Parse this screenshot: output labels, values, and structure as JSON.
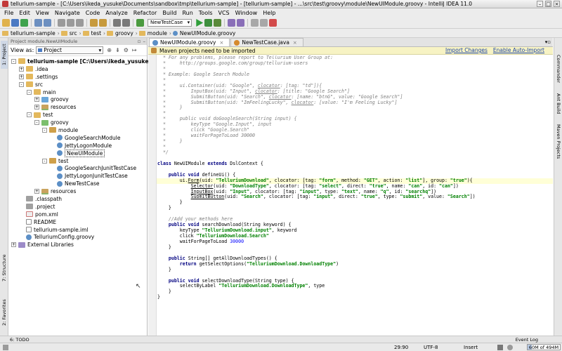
{
  "window": {
    "title": "tellurium-sample - [C:\\Users\\ikeda_yusuke\\Documents\\sandbox\\tmp\\tellurium-sample] - [tellurium-sample] - ...\\src\\test\\groovy\\module\\NewUIModule.groovy - IntelliJ IDEA 11.0"
  },
  "menu": [
    "File",
    "Edit",
    "View",
    "Navigate",
    "Code",
    "Analyze",
    "Refactor",
    "Build",
    "Run",
    "Tools",
    "VCS",
    "Window",
    "Help"
  ],
  "toolbar": {
    "run_config": "NewTestCase"
  },
  "breadcrumbs": [
    "tellurium-sample",
    "src",
    "test",
    "groovy",
    "module",
    "NewUIModule.groovy"
  ],
  "left_tools": {
    "project": "1: Project",
    "structure": "7: Structure",
    "favorites": "2: Favorites"
  },
  "project_panel": {
    "header": "Project module.NewUIModule",
    "view_as_label": "View as:",
    "view_as_value": "Project",
    "tree": [
      {
        "label": "tellurium-sample [C:\\Users\\ikeda_yusuke\\Documents\\sandbox\\tmp\\tellurium-sample]",
        "depth": 0,
        "icon": "folder",
        "toggle": "-",
        "bold": true
      },
      {
        "label": ".idea",
        "depth": 1,
        "icon": "folder",
        "toggle": "+"
      },
      {
        "label": ".settings",
        "depth": 1,
        "icon": "folder",
        "toggle": "+"
      },
      {
        "label": "src",
        "depth": 1,
        "icon": "folder",
        "toggle": "-"
      },
      {
        "label": "main",
        "depth": 2,
        "icon": "folder",
        "toggle": "-"
      },
      {
        "label": "groovy",
        "depth": 3,
        "icon": "src",
        "toggle": "+"
      },
      {
        "label": "resources",
        "depth": 3,
        "icon": "res",
        "toggle": "+"
      },
      {
        "label": "test",
        "depth": 2,
        "icon": "folder",
        "toggle": "-"
      },
      {
        "label": "groovy",
        "depth": 3,
        "icon": "test",
        "toggle": "-"
      },
      {
        "label": "module",
        "depth": 4,
        "icon": "pkg",
        "toggle": "-"
      },
      {
        "label": "GoogleSearchModule",
        "depth": 5,
        "icon": "groovy",
        "toggle": ""
      },
      {
        "label": "JettyLogonModule",
        "depth": 5,
        "icon": "groovy",
        "toggle": ""
      },
      {
        "label": "NewUIModule",
        "depth": 5,
        "icon": "groovy",
        "toggle": "",
        "selected": true
      },
      {
        "label": "test",
        "depth": 4,
        "icon": "pkg",
        "toggle": "-"
      },
      {
        "label": "GoogleSearchJunitTestCase",
        "depth": 5,
        "icon": "groovy",
        "toggle": ""
      },
      {
        "label": "JettyLogonJunitTestCase",
        "depth": 5,
        "icon": "groovy",
        "toggle": ""
      },
      {
        "label": "NewTestCase",
        "depth": 5,
        "icon": "groovy",
        "toggle": ""
      },
      {
        "label": "resources",
        "depth": 3,
        "icon": "res",
        "toggle": "+"
      },
      {
        "label": ".classpath",
        "depth": 1,
        "icon": "proj",
        "toggle": ""
      },
      {
        "label": ".project",
        "depth": 1,
        "icon": "proj",
        "toggle": ""
      },
      {
        "label": "pom.xml",
        "depth": 1,
        "icon": "xml",
        "toggle": ""
      },
      {
        "label": "README",
        "depth": 1,
        "icon": "file",
        "toggle": ""
      },
      {
        "label": "tellurium-sample.iml",
        "depth": 1,
        "icon": "file",
        "toggle": ""
      },
      {
        "label": "TelluriumConfig.groovy",
        "depth": 1,
        "icon": "groovy",
        "toggle": ""
      },
      {
        "label": "External Libraries",
        "depth": 0,
        "icon": "libs",
        "toggle": "+"
      }
    ]
  },
  "editor": {
    "tabs": [
      {
        "label": "NewUIModule.groovy",
        "active": true
      },
      {
        "label": "NewTestCase.java",
        "active": false
      }
    ],
    "notification": {
      "text": "Maven projects need to be imported",
      "import_link": "Import Changes",
      "auto_link": "Enable Auto-Import"
    },
    "lines": [
      [
        [
          "cm",
          "  * For any problems, please report to Tellurium User Group at:"
        ]
      ],
      [
        [
          "cm",
          "  *     http://groups.google.com/group/tellurium-users"
        ]
      ],
      [
        [
          "cm",
          "  *"
        ]
      ],
      [
        [
          "cm",
          "  * Example: Google Search Module"
        ]
      ],
      [
        [
          "cm",
          "  *"
        ]
      ],
      [
        [
          "cm",
          "  *     ui.Container(uid: \"Google\", "
        ],
        [
          "cmr",
          "clocator"
        ],
        [
          "cm",
          ": [tag: \"td\"]){"
        ]
      ],
      [
        [
          "cm",
          "  *         InputBox(uid: \"Input\", "
        ],
        [
          "cmr",
          "clocator"
        ],
        [
          "cm",
          ": [title: \"Google Search\"]"
        ]
      ],
      [
        [
          "cm",
          "  *         SubmitButton(uid: \"Search\", "
        ],
        [
          "cmr",
          "clocator"
        ],
        [
          "cm",
          ": [name: \"btnG\", value: \"Google Search\"]"
        ]
      ],
      [
        [
          "cm",
          "  *         SubmitButton(uid: \"ImFeelingLucky\", "
        ],
        [
          "cmr",
          "clocator"
        ],
        [
          "cm",
          ": [value: \"I'm Feeling Lucky\"]"
        ]
      ],
      [
        [
          "cm",
          "  *     }"
        ]
      ],
      [
        [
          "cm",
          "  *"
        ]
      ],
      [
        [
          "cm",
          "  *     public void doGoogleSearch(String input) {"
        ]
      ],
      [
        [
          "cm",
          "  *         keyType \"Google.Input\", input"
        ]
      ],
      [
        [
          "cm",
          "  *         click \"Google.Search\""
        ]
      ],
      [
        [
          "cm",
          "  *         waitForPageToLoad 30000"
        ]
      ],
      [
        [
          "cm",
          "  *     }"
        ]
      ],
      [
        [
          "cm",
          "  *"
        ]
      ],
      [
        [
          "cm",
          "  */"
        ]
      ],
      [],
      [
        [
          "kw",
          "class "
        ],
        [
          "",
          "NewUIModule "
        ],
        [
          "kw",
          "extends "
        ],
        [
          "",
          "DslContext {"
        ]
      ],
      [],
      [
        [
          "",
          "    "
        ],
        [
          "kw",
          "public void "
        ],
        [
          "",
          "defineUi() {"
        ]
      ],
      [
        [
          "",
          "        ui."
        ],
        [
          "fn",
          "Form"
        ],
        [
          "",
          "(uid: "
        ],
        [
          "str",
          "\"TelluriumDownload\""
        ],
        [
          "",
          ", clocator: [tag: "
        ],
        [
          "str",
          "\"form\""
        ],
        [
          "",
          ", method: "
        ],
        [
          "str",
          "\"GET\""
        ],
        [
          "",
          ", action: "
        ],
        [
          "str",
          "\"list\""
        ],
        [
          "",
          "], group: "
        ],
        [
          "str",
          "\"true\""
        ],
        [
          "",
          ")"
        ],
        [
          "",
          "{"
        ]
      ],
      [
        [
          "",
          "            "
        ],
        [
          "fn",
          "Selector"
        ],
        [
          "",
          "(uid: "
        ],
        [
          "str",
          "\"DownloadType\""
        ],
        [
          "",
          ", clocator: [tag: "
        ],
        [
          "str",
          "\"select\""
        ],
        [
          "",
          ", direct: "
        ],
        [
          "str",
          "\"true\""
        ],
        [
          "",
          ", name: "
        ],
        [
          "str",
          "\"can\""
        ],
        [
          "",
          ", id: "
        ],
        [
          "str",
          "\"can\""
        ],
        [
          "",
          "])"
        ]
      ],
      [
        [
          "",
          "            "
        ],
        [
          "fn",
          "InputBox"
        ],
        [
          "",
          "(uid: "
        ],
        [
          "str",
          "\"Input\""
        ],
        [
          "",
          ", clocator: [tag: "
        ],
        [
          "str",
          "\"input\""
        ],
        [
          "",
          ", type: "
        ],
        [
          "str",
          "\"text\""
        ],
        [
          "",
          ", name: "
        ],
        [
          "str",
          "\"q\""
        ],
        [
          "",
          ", id: "
        ],
        [
          "str",
          "\"searchq\""
        ],
        [
          "",
          "])"
        ]
      ],
      [
        [
          "",
          "            "
        ],
        [
          "fn",
          "SubmitButton"
        ],
        [
          "",
          "(uid: "
        ],
        [
          "str",
          "\"Search\""
        ],
        [
          "",
          ", clocator: [tag: "
        ],
        [
          "str",
          "\"input\""
        ],
        [
          "",
          ", direct: "
        ],
        [
          "str",
          "\"true\""
        ],
        [
          "",
          ", type: "
        ],
        [
          "str",
          "\"submit\""
        ],
        [
          "",
          ", value: "
        ],
        [
          "str",
          "\"Search\""
        ],
        [
          "",
          "])"
        ]
      ],
      [
        [
          "",
          "        }"
        ]
      ],
      [
        [
          "",
          "    }"
        ]
      ],
      [],
      [
        [
          "cm",
          "    //Add your methods here"
        ]
      ],
      [
        [
          "",
          "    "
        ],
        [
          "kw",
          "public void "
        ],
        [
          "",
          "searchDownload(String keyword) {"
        ]
      ],
      [
        [
          "",
          "        keyType "
        ],
        [
          "str",
          "\"TelluriumDownload.input\""
        ],
        [
          "",
          ", keyword"
        ]
      ],
      [
        [
          "",
          "        click "
        ],
        [
          "str",
          "\"TelluriumDownload.Search\""
        ]
      ],
      [
        [
          "",
          "        waitForPageToLoad "
        ],
        [
          "num",
          "30000"
        ]
      ],
      [
        [
          "",
          "    }"
        ]
      ],
      [],
      [
        [
          "",
          "    "
        ],
        [
          "kw",
          "public "
        ],
        [
          "",
          "String[] getAllDownloadTypes() {"
        ]
      ],
      [
        [
          "",
          "        "
        ],
        [
          "kw",
          "return "
        ],
        [
          "",
          "getSelectOptions("
        ],
        [
          "str",
          "\"TelluriumDownload.DownloadType\""
        ],
        [
          "",
          ")"
        ]
      ],
      [
        [
          "",
          "    }"
        ]
      ],
      [],
      [
        [
          "",
          "    "
        ],
        [
          "kw",
          "public void "
        ],
        [
          "",
          "selectDownloadType(String type) {"
        ]
      ],
      [
        [
          "",
          "        selectByLabel "
        ],
        [
          "str",
          "\"TelluriumDownload.DownloadType\""
        ],
        [
          "",
          ", type"
        ]
      ],
      [
        [
          "",
          "    }"
        ]
      ],
      [
        [
          "",
          "}"
        ]
      ]
    ]
  },
  "right_tools": {
    "commander": "Commander",
    "ant": "Ant Build",
    "maven": "Maven Projects"
  },
  "bottom_tools": {
    "todo": "6: TODO",
    "event_log": "Event Log"
  },
  "status": {
    "position": "29:90",
    "encoding": "UTF-8",
    "insert": "Insert",
    "memory": "60M of 494M",
    "memory_fraction": 0.12
  }
}
